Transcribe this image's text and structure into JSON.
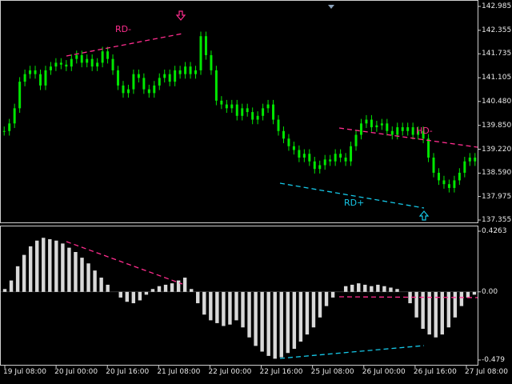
{
  "colors": {
    "background": "#000000",
    "candles": "#00e600",
    "bear_divergence": "#ff2d8e",
    "bull_divergence": "#16c8e8",
    "histogram": "#d8d8d8",
    "axis": "#cfcfcf",
    "text": "#e8e8e8",
    "zero_line": "#cfcfcf"
  },
  "price_axis": {
    "labels": [
      "142.985",
      "142.355",
      "141.735",
      "141.105",
      "140.480",
      "139.850",
      "139.220",
      "138.590",
      "137.975",
      "137.355"
    ]
  },
  "indicator_axis": {
    "labels": [
      "0.4263",
      "0.00",
      "-0.479"
    ]
  },
  "time_axis": {
    "labels": [
      "19 Jul 08:00",
      "20 Jul 00:00",
      "20 Jul 16:00",
      "21 Jul 08:00",
      "22 Jul 00:00",
      "22 Jul 16:00",
      "25 Jul 08:00",
      "26 Jul 00:00",
      "26 Jul 16:00",
      "27 Jul 08:00"
    ]
  },
  "annotations": {
    "rd_minus": "RD-",
    "hd_minus": "HD-",
    "rd_plus": "RD+",
    "down_arrow_icon": "down-arrow-icon",
    "up_arrow_icon": "up-arrow-icon"
  },
  "chart_data": [
    {
      "type": "candlestick",
      "y_axis_ticks": [
        142.985,
        142.355,
        141.735,
        141.105,
        140.48,
        139.85,
        139.22,
        138.59,
        137.975,
        137.355
      ],
      "ylim": [
        137.355,
        142.985
      ],
      "x_ticks": [
        "19 Jul 08:00",
        "20 Jul 00:00",
        "20 Jul 16:00",
        "21 Jul 08:00",
        "22 Jul 00:00",
        "22 Jul 16:00",
        "25 Jul 08:00",
        "26 Jul 00:00",
        "26 Jul 16:00",
        "27 Jul 08:00"
      ],
      "close_path": [
        139.7,
        139.9,
        140.3,
        141.0,
        141.2,
        141.3,
        141.2,
        140.9,
        141.3,
        141.4,
        141.5,
        141.45,
        141.4,
        141.6,
        141.7,
        141.5,
        141.6,
        141.4,
        141.5,
        141.8,
        141.6,
        141.3,
        140.9,
        140.7,
        140.8,
        141.2,
        141.1,
        140.8,
        140.7,
        140.9,
        141.1,
        141.2,
        141.0,
        141.3,
        141.2,
        141.4,
        141.2,
        141.3,
        142.2,
        141.7,
        141.3,
        140.5,
        140.4,
        140.3,
        140.4,
        140.1,
        140.3,
        140.2,
        140.0,
        140.1,
        140.3,
        140.4,
        140.0,
        139.7,
        139.5,
        139.3,
        139.2,
        139.0,
        139.1,
        138.9,
        138.7,
        138.8,
        138.95,
        138.9,
        139.1,
        139.0,
        138.9,
        139.3,
        139.6,
        139.9,
        140.0,
        139.8,
        139.85,
        139.9,
        139.7,
        139.6,
        139.8,
        139.7,
        139.8,
        139.6,
        139.7,
        139.5,
        139.0,
        138.6,
        138.4,
        138.3,
        138.2,
        138.4,
        138.6,
        138.9,
        139.0,
        138.9
      ]
    },
    {
      "type": "bar",
      "name": "",
      "ylim": [
        -0.479,
        0.4263
      ],
      "values": [
        0.02,
        0.08,
        0.18,
        0.26,
        0.32,
        0.36,
        0.38,
        0.37,
        0.36,
        0.34,
        0.31,
        0.28,
        0.24,
        0.2,
        0.15,
        0.1,
        0.05,
        0.0,
        -0.04,
        -0.07,
        -0.08,
        -0.06,
        -0.02,
        0.02,
        0.04,
        0.05,
        0.06,
        0.08,
        0.1,
        0.02,
        -0.08,
        -0.16,
        -0.2,
        -0.22,
        -0.24,
        -0.23,
        -0.2,
        -0.25,
        -0.32,
        -0.38,
        -0.42,
        -0.45,
        -0.47,
        -0.46,
        -0.43,
        -0.4,
        -0.35,
        -0.3,
        -0.25,
        -0.18,
        -0.1,
        -0.04,
        0.0,
        0.04,
        0.05,
        0.06,
        0.05,
        0.04,
        0.05,
        0.04,
        0.03,
        0.02,
        0.0,
        -0.08,
        -0.18,
        -0.26,
        -0.3,
        -0.32,
        -0.3,
        -0.25,
        -0.18,
        -0.1,
        -0.04,
        -0.02
      ]
    }
  ]
}
